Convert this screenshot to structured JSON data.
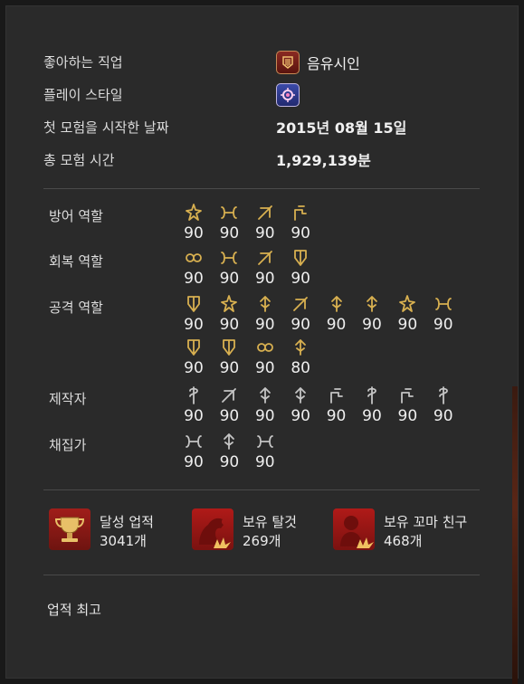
{
  "profile": {
    "favorite_job_label": "좋아하는 직업",
    "favorite_job_value": "음유시인",
    "playstyle_label": "플레이 스타일",
    "start_date_label": "첫 모험을 시작한 날짜",
    "start_date_value": "2015년 08월 15일",
    "playtime_label": "총 모험 시간",
    "playtime_value": "1,929,139분"
  },
  "jobs": {
    "tank": {
      "label": "방어 역할",
      "levels": [
        "90",
        "90",
        "90",
        "90"
      ],
      "icons": [
        "paladin-icon",
        "warrior-icon",
        "dark-knight-icon",
        "gunbreaker-icon"
      ]
    },
    "healer": {
      "label": "회복 역할",
      "levels": [
        "90",
        "90",
        "90",
        "90"
      ],
      "icons": [
        "white-mage-icon",
        "scholar-icon",
        "astrologian-icon",
        "sage-icon"
      ]
    },
    "dps": {
      "label": "공격 역할",
      "levels": [
        "90",
        "90",
        "90",
        "90",
        "90",
        "90",
        "90",
        "90",
        "90",
        "90",
        "90",
        "80"
      ],
      "icons": [
        "monk-icon",
        "dragoon-icon",
        "ninja-icon",
        "samurai-icon",
        "reaper-icon",
        "bard-icon",
        "machinist-icon",
        "dancer-icon",
        "black-mage-icon",
        "summoner-icon",
        "red-mage-icon",
        "blue-mage-icon"
      ]
    },
    "crafter": {
      "label": "제작자",
      "levels": [
        "90",
        "90",
        "90",
        "90",
        "90",
        "90",
        "90",
        "90"
      ],
      "icons": [
        "carpenter-icon",
        "blacksmith-icon",
        "armorer-icon",
        "goldsmith-icon",
        "leatherworker-icon",
        "weaver-icon",
        "alchemist-icon",
        "culinarian-icon"
      ]
    },
    "gatherer": {
      "label": "채집가",
      "levels": [
        "90",
        "90",
        "90"
      ],
      "icons": [
        "miner-icon",
        "botanist-icon",
        "fisher-icon"
      ]
    }
  },
  "achievements": {
    "ach_label": "달성 업적",
    "ach_value": "3041개",
    "mount_label": "보유 탈것",
    "mount_value": "269개",
    "minion_label": "보유 꼬마 친구",
    "minion_value": "468개"
  },
  "bottom": {
    "title": "업적 최고"
  },
  "colors": {
    "panel": "#2a2a2a",
    "gold": "#d8b050",
    "silver": "#c4c4c4",
    "red": "#a01e1a"
  }
}
